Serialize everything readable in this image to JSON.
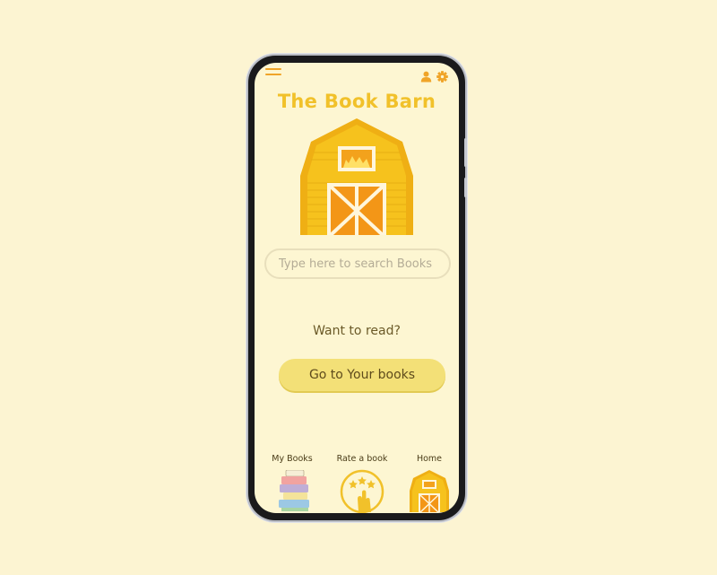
{
  "app": {
    "title": "The Book Barn"
  },
  "search": {
    "placeholder": "Type here to search Books"
  },
  "prompt": "Want to read?",
  "cta": {
    "label": "Go to Your books"
  },
  "nav": [
    {
      "label": "My Books",
      "icon": "book-stack-icon"
    },
    {
      "label": "Rate a book",
      "icon": "rate-stars-hand-icon"
    },
    {
      "label": "Home",
      "icon": "barn-home-icon"
    }
  ],
  "colors": {
    "background": "#fcf4d2",
    "title": "#f1c12a",
    "accent": "#f0a428",
    "barn_body": "#f6c21d",
    "barn_door": "#f39617",
    "button": "#f3e077",
    "text": "#6b5a28"
  }
}
